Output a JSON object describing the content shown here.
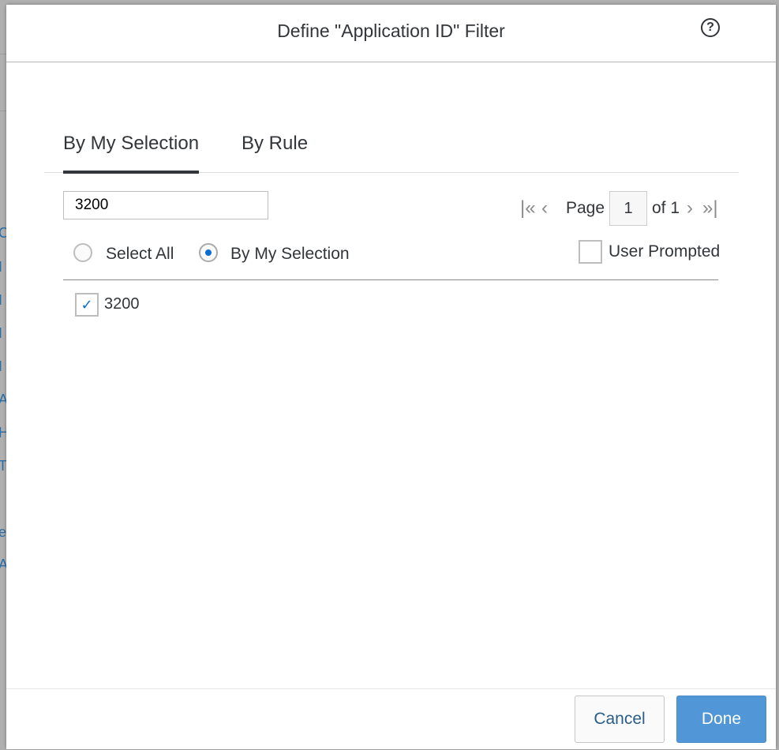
{
  "background": {
    "link_fragments": [
      "C",
      "I",
      "I",
      "I",
      "I",
      "A",
      "H",
      "T",
      "e",
      "A"
    ]
  },
  "dialog": {
    "title": "Define \"Application ID\" Filter",
    "help_icon": "question-circle-icon",
    "tabs": [
      {
        "label": "By My Selection",
        "active": true
      },
      {
        "label": "By Rule",
        "active": false
      }
    ],
    "search": {
      "value": "3200",
      "placeholder": ""
    },
    "pager": {
      "page_label": "Page",
      "current_page": "1",
      "of_label": "of 1"
    },
    "selection_mode": {
      "select_all_label": "Select All",
      "by_my_selection_label": "By My Selection",
      "selected": "By My Selection"
    },
    "user_prompted": {
      "label": "User Prompted",
      "checked": false
    },
    "values": [
      {
        "label": "3200",
        "checked": true
      }
    ],
    "footer": {
      "cancel_label": "Cancel",
      "done_label": "Done"
    }
  },
  "colors": {
    "accent": "#0a6ed1",
    "done_button": "#5196d6",
    "text": "#32363a"
  }
}
